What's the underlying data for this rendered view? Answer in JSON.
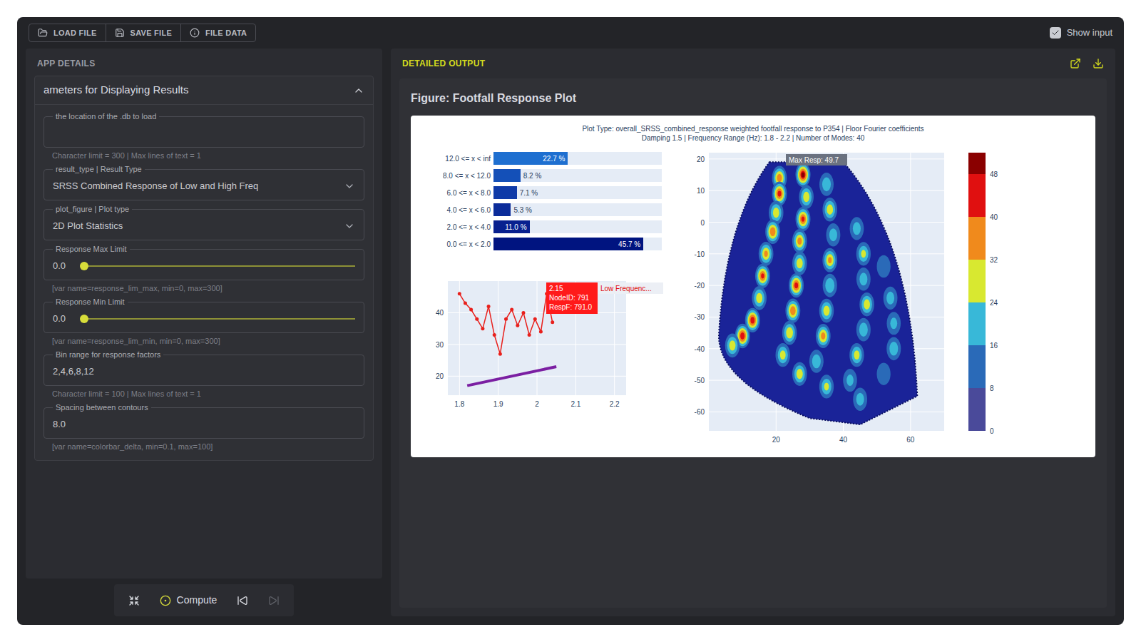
{
  "toolbar": {
    "buttons": [
      "LOAD FILE",
      "SAVE FILE",
      "FILE DATA"
    ]
  },
  "show_input": {
    "label": "Show input",
    "checked": true
  },
  "sidebar": {
    "title": "APP DETAILS",
    "section": {
      "title": "ameters for Displaying Results",
      "expanded": true,
      "fields": [
        {
          "kind": "text",
          "label": "the location of the .db to load",
          "value": "",
          "hint": "Character limit = 300 | Max lines of text = 1"
        },
        {
          "kind": "select",
          "label": "result_type | Result Type",
          "value": "SRSS Combined Response of Low and High Freq",
          "hint": ""
        },
        {
          "kind": "select",
          "label": "plot_figure | Plot type",
          "value": "2D Plot Statistics",
          "hint": ""
        },
        {
          "kind": "slider",
          "label": "Response Max Limit",
          "value": "0.0",
          "level": 0,
          "hint": "[var name=response_lim_max, min=0, max=300]"
        },
        {
          "kind": "slider",
          "label": "Response Min Limit",
          "value": "0.0",
          "level": 0,
          "hint": "[var name=response_lim_min, min=0, max=300]"
        },
        {
          "kind": "text",
          "label": "Bin range for response factors",
          "value": "2,4,6,8,12",
          "hint": "Character limit = 100 | Max lines of text = 1"
        },
        {
          "kind": "text",
          "label": "Spacing between contours",
          "value": "8.0",
          "hint": "[var name=colorbar_delta, min=0.1, max=100]"
        }
      ]
    }
  },
  "actions": [
    {
      "kind": "reset",
      "label": "",
      "disabled": false
    },
    {
      "kind": "compute",
      "label": "Compute",
      "disabled": false
    },
    {
      "kind": "first",
      "label": "",
      "disabled": false
    },
    {
      "kind": "last",
      "label": "",
      "disabled": true
    }
  ],
  "output": {
    "title": "DETAILED OUTPUT",
    "figure": {
      "title": "Figure: Footfall Response Plot",
      "plot_title": [
        "Plot Type: overall_SRSS_combined_response weighted footfall response to P354 | Floor Fourier coefficients",
        "Damping 1.5 | Frequency Range (Hz): 1.8 - 2.2 | Number of Modes: 40"
      ],
      "histogram": {
        "max": 50,
        "bins": [
          {
            "label": "12.0 <= x < inf",
            "value": 22.7,
            "text": "22.7 %",
            "color": "#1e6fd0"
          },
          {
            "label": "8.0 <= x < 12.0",
            "value": 8.2,
            "text": "8.2 %",
            "color": "#1450b8"
          },
          {
            "label": "6.0 <= x < 8.0",
            "value": 7.1,
            "text": "7.1 %",
            "color": "#0e3aa8"
          },
          {
            "label": "4.0 <= x < 6.0",
            "value": 5.3,
            "text": "5.3 %",
            "color": "#0b2c9a"
          },
          {
            "label": "2.0 <= x < 4.0",
            "value": 11.0,
            "text": "11.0 %",
            "color": "#08208f"
          },
          {
            "label": "0.0 <= x < 2.0",
            "value": 45.7,
            "text": "45.7 %",
            "color": "#001480"
          }
        ]
      },
      "line_chart": {
        "x_ticks": [
          "1.8",
          "1.9",
          "2",
          "2.1",
          "2.2"
        ],
        "y_ticks": [
          "20",
          "30",
          "40"
        ],
        "series": [
          {
            "name": "response",
            "color": "#e8201c",
            "markers": true,
            "x": [
              1.8,
              1.815,
              1.83,
              1.845,
              1.86,
              1.875,
              1.89,
              1.905,
              1.92,
              1.935,
              1.95,
              1.965,
              1.98,
              1.995,
              2.01,
              2.025,
              2.04
            ],
            "y": [
              46,
              43,
              41,
              38,
              35,
              42,
              33,
              27,
              38,
              41,
              36,
              40,
              33,
              38,
              34,
              46,
              37
            ]
          },
          {
            "name": "limit",
            "color": "#7b1fa2",
            "markers": false,
            "x": [
              1.82,
              2.05
            ],
            "y": [
              17,
              23
            ]
          }
        ],
        "tooltip": {
          "lines": [
            "2.15",
            "NodeID: 791",
            "RespF: 791.0"
          ],
          "label": "Low Frequenc..."
        }
      },
      "contour": {
        "x_ticks": [
          "20",
          "40",
          "60"
        ],
        "y_ticks": [
          "20",
          "10",
          "0",
          "-10",
          "-20",
          "-30",
          "-40",
          "-50",
          "-60"
        ],
        "max_label": "Max Resp: 49.7",
        "hotspots": [
          [
            21,
            14,
            38
          ],
          [
            21,
            9,
            44
          ],
          [
            20,
            3,
            30
          ],
          [
            19,
            -3,
            40
          ],
          [
            17,
            -10,
            34
          ],
          [
            16,
            -17,
            42
          ],
          [
            15,
            -24,
            30
          ],
          [
            13,
            -31,
            46
          ],
          [
            10,
            -36,
            47
          ],
          [
            7,
            -39,
            30
          ],
          [
            28,
            15,
            49.7
          ],
          [
            29,
            8,
            30
          ],
          [
            28,
            1,
            42
          ],
          [
            27,
            -6,
            36
          ],
          [
            27,
            -13,
            30
          ],
          [
            26,
            -20,
            44
          ],
          [
            25,
            -28,
            40
          ],
          [
            24,
            -35,
            32
          ],
          [
            22,
            -42,
            28
          ],
          [
            27,
            -48,
            30
          ],
          [
            35,
            12,
            22
          ],
          [
            36,
            4,
            30
          ],
          [
            37,
            -4,
            20
          ],
          [
            36,
            -12,
            34
          ],
          [
            36,
            -20,
            24
          ],
          [
            35,
            -28,
            30
          ],
          [
            34,
            -36,
            36
          ],
          [
            32,
            -44,
            22
          ],
          [
            35,
            -52,
            26
          ],
          [
            44,
            -2,
            20
          ],
          [
            46,
            -10,
            26
          ],
          [
            46,
            -18,
            20
          ],
          [
            47,
            -26,
            30
          ],
          [
            46,
            -34,
            22
          ],
          [
            44,
            -42,
            28
          ],
          [
            42,
            -50,
            18
          ],
          [
            45,
            -56,
            20
          ],
          [
            52,
            -14,
            16
          ],
          [
            54,
            -24,
            20
          ],
          [
            55,
            -32,
            18
          ],
          [
            55,
            -40,
            22
          ],
          [
            52,
            -48,
            16
          ]
        ]
      },
      "colorbar": {
        "ticks": [
          "48",
          "40",
          "32",
          "24",
          "16",
          "8",
          "0"
        ]
      }
    }
  }
}
